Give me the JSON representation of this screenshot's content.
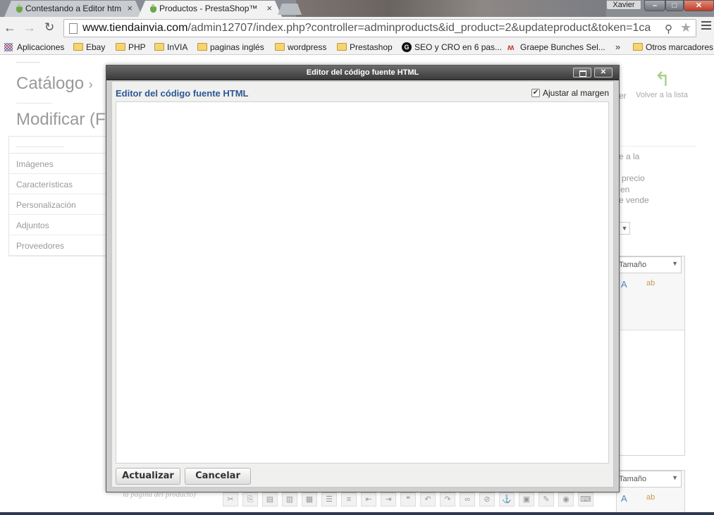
{
  "browser": {
    "tabs": [
      {
        "title": "Contestando a Editor htm",
        "active": false
      },
      {
        "title": "Productos - PrestaShop™",
        "active": true
      }
    ],
    "user": "Xavier",
    "url_host": "www.tiendainvia.com",
    "url_path": "/admin12707/index.php?controller=adminproducts&id_product=2&updateproduct&token=1ca",
    "bookmarks": [
      {
        "label": "Aplicaciones",
        "icon": "apps-icon"
      },
      {
        "label": "Ebay",
        "icon": "folder-icon"
      },
      {
        "label": "PHP",
        "icon": "folder-icon"
      },
      {
        "label": "InVIA",
        "icon": "folder-icon"
      },
      {
        "label": "paginas inglés",
        "icon": "folder-icon"
      },
      {
        "label": "wordpress",
        "icon": "folder-icon"
      },
      {
        "label": "Prestashop",
        "icon": "folder-icon"
      },
      {
        "label": "SEO y CRO en 6 pas...",
        "icon": "g-icon"
      },
      {
        "label": "Graepe Bunches Sel...",
        "icon": "grape-icon"
      },
      {
        "label": "Otros marcadores",
        "icon": "folder-icon"
      }
    ],
    "bookmarks_more": "»"
  },
  "page": {
    "title1": "Catálogo",
    "title1_sep": "›",
    "title2": "Modificar (F",
    "side_menu": [
      "Imágenes",
      "Características",
      "Personalización",
      "Adjuntos",
      "Proveedores"
    ],
    "back_to_list": "Volver a la lista",
    "right_snippets": {
      "line1": "e a la",
      "line2": "precio",
      "line3": "en",
      "line4": "e vende",
      "line5": "er"
    },
    "size_label": "Tamaño",
    "italic_hint": "la página del producto)"
  },
  "modal": {
    "title": "Editor del código fuente HTML",
    "heading": "Editor del código fuente HTML",
    "wrap_label": "Ajustar al margen",
    "wrap_checked": true,
    "code": "",
    "update_button": "Actualizar",
    "cancel_button": "Cancelar"
  },
  "colors": {
    "heading": "#2b5797",
    "titlebar": "#4a4a4a"
  }
}
